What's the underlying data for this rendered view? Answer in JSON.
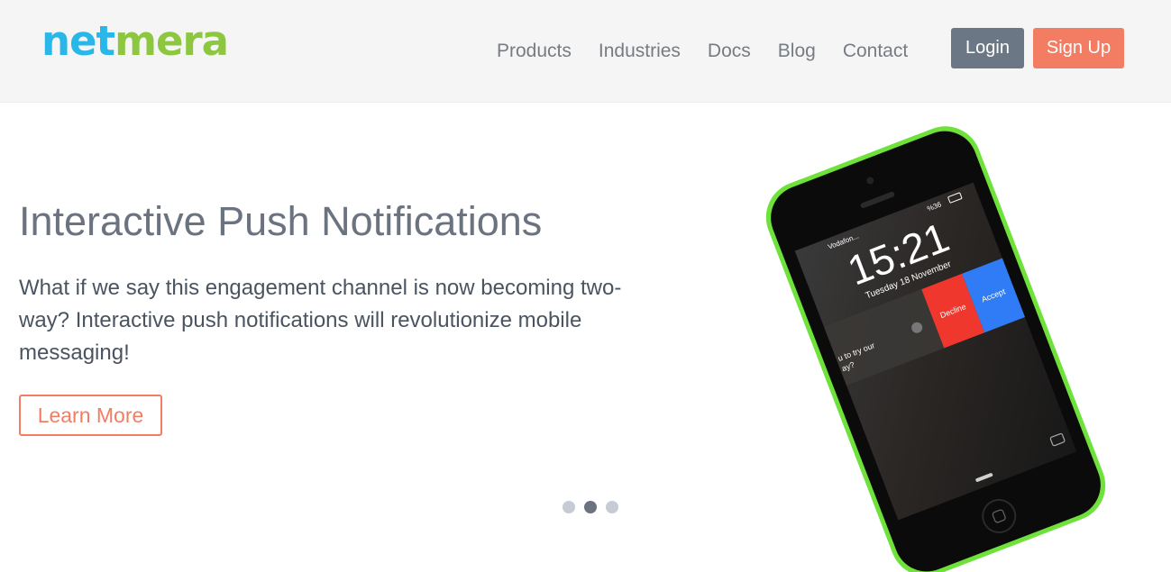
{
  "header": {
    "logo": {
      "part1": "net",
      "part2": "mera"
    },
    "nav": [
      "Products",
      "Industries",
      "Docs",
      "Blog",
      "Contact"
    ],
    "login_label": "Login",
    "signup_label": "Sign Up"
  },
  "hero": {
    "title": "Interactive Push Notifications",
    "text": "What if we say this engagement channel is now becoming two-way? Interactive push notifications will revolutionize mobile messaging!",
    "cta_label": "Learn More"
  },
  "carousel": {
    "active_slide": 2,
    "slide_count": 3
  },
  "phone": {
    "carrier": "Vodafon...",
    "battery": "%36",
    "time": "15:21",
    "date": "Tuesday 18 November",
    "decline_label": "Decline",
    "accept_label": "Accept",
    "notif_line1": "u to try our",
    "notif_line2": "ay?"
  },
  "colors": {
    "logo_blue": "#29b6e8",
    "logo_green": "#8dc63f",
    "accent_coral": "#f27d62",
    "slate": "#6c7785",
    "phone_green": "#6ee13a",
    "accept_blue": "#2f7cf6",
    "decline_red": "#f0372d"
  }
}
